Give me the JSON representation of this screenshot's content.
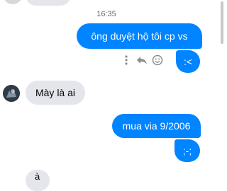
{
  "timestamp": "16:35",
  "messages": [
    {
      "direction": "outgoing",
      "text": "ông duyệt hộ tôi cp  vs"
    },
    {
      "direction": "outgoing",
      "text": ":<"
    },
    {
      "direction": "incoming",
      "text": "Mày là ai"
    },
    {
      "direction": "outgoing",
      "text": "mua via 9/2006"
    },
    {
      "direction": "outgoing",
      "text": ";-;"
    },
    {
      "direction": "incoming",
      "text": "à"
    }
  ],
  "message_actions": {
    "icons": [
      "more-vertical-icon",
      "reply-icon",
      "react-emoji-icon"
    ]
  },
  "colors": {
    "outgoing_bubble": "#0084ff",
    "incoming_bubble": "#e4e6eb",
    "timestamp": "#65676b",
    "action_icons": "#8a8d91"
  }
}
